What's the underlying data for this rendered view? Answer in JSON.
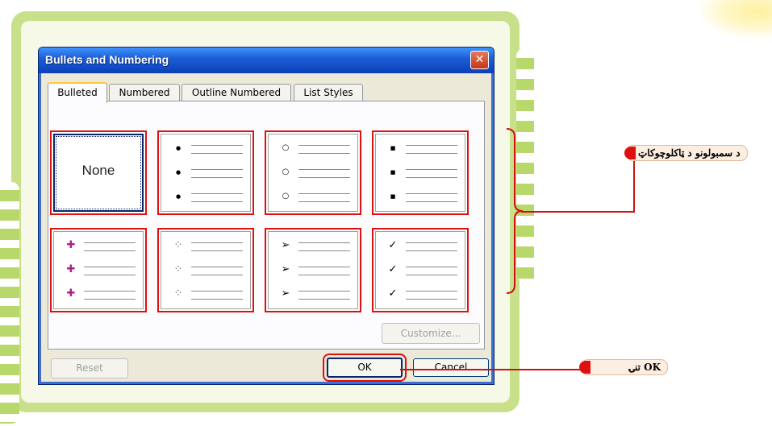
{
  "dialog": {
    "title": "Bullets and Numbering",
    "close_glyph": "✕",
    "tabs": [
      {
        "label": "Bulleted",
        "active": true
      },
      {
        "label": "Numbered",
        "active": false
      },
      {
        "label": "Outline Numbered",
        "active": false
      },
      {
        "label": "List Styles",
        "active": false
      }
    ],
    "gallery": [
      {
        "kind": "none",
        "label": "None",
        "icon": "none"
      },
      {
        "kind": "bullet",
        "glyph": "●",
        "icon": "filled-circle-bullet-icon"
      },
      {
        "kind": "bullet",
        "glyph": "○",
        "icon": "hollow-circle-bullet-icon"
      },
      {
        "kind": "bullet",
        "glyph": "■",
        "icon": "square-bullet-icon"
      },
      {
        "kind": "bullet",
        "glyph": "✚",
        "icon": "colorful-cross-bullet-icon"
      },
      {
        "kind": "bullet",
        "glyph": "⁘",
        "icon": "four-diamond-bullet-icon"
      },
      {
        "kind": "bullet",
        "glyph": "➢",
        "icon": "arrowhead-bullet-icon"
      },
      {
        "kind": "bullet",
        "glyph": "✓",
        "icon": "checkmark-bullet-icon"
      }
    ],
    "buttons": {
      "customize": "Customize...",
      "reset": "Reset",
      "ok": "OK",
      "cancel": "Cancel"
    }
  },
  "annotations": {
    "gallery_callout": "د سمبولونو د ټاکلوچوکاټ",
    "ok_callout": "OK تنۍ"
  },
  "colors": {
    "highlight": "#e01010",
    "title_bar": "#0a3fb8",
    "background_green": "#c9e08a"
  }
}
